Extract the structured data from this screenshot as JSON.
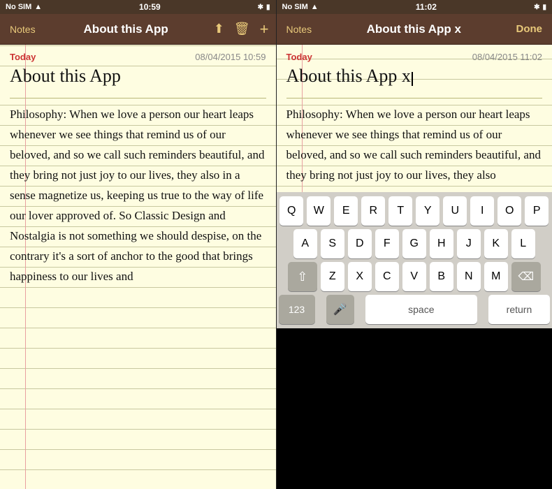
{
  "left_panel": {
    "status": {
      "carrier": "No SIM",
      "wifi": "WiFi",
      "time": "10:59",
      "bluetooth": "BT",
      "battery": "Battery"
    },
    "nav": {
      "back_label": "Notes",
      "title": "About this App",
      "action_share": "share",
      "action_trash": "trash",
      "action_add": "add"
    },
    "note": {
      "date_today": "Today",
      "date_full": "08/04/2015 10:59",
      "title": "About this App",
      "body": "Philosophy: When we love a person our heart leaps whenever we see things that remind us of our beloved, and so we call such reminders beautiful, and they bring not just joy to our lives, they also in a sense magnetize us, keeping us true to the way of life our lover approved of. So Classic Design and Nostalgia is not something we should despise, on the contrary it's a sort of anchor to the good that brings happiness to our lives and"
    }
  },
  "right_panel": {
    "status": {
      "carrier": "No SIM",
      "wifi": "WiFi",
      "time": "11:02",
      "bluetooth": "BT",
      "battery": "Battery"
    },
    "nav": {
      "back_label": "Notes",
      "title": "About this App x",
      "done_label": "Done"
    },
    "note": {
      "date_today": "Today",
      "date_full": "08/04/2015 11:02",
      "title": "About this App x",
      "body": "Philosophy: When we love a person our heart leaps whenever we see things that remind us of our beloved, and so we call such reminders beautiful, and they bring not just joy to our lives, they also"
    },
    "keyboard": {
      "rows": [
        [
          "Q",
          "W",
          "E",
          "R",
          "T",
          "Y",
          "U",
          "I",
          "O",
          "P"
        ],
        [
          "A",
          "S",
          "D",
          "F",
          "G",
          "H",
          "J",
          "K",
          "L"
        ],
        [
          "Z",
          "X",
          "C",
          "V",
          "B",
          "N",
          "M"
        ]
      ],
      "bottom": {
        "num_label": "123",
        "space_label": "space",
        "return_label": "return"
      }
    }
  }
}
